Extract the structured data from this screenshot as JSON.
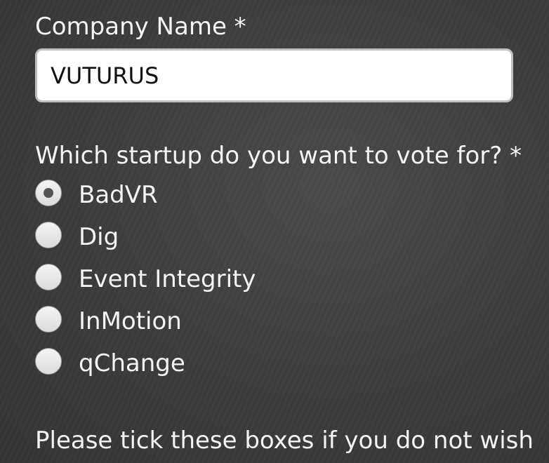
{
  "company_field": {
    "label": "Company Name *",
    "value": "VUTURUS"
  },
  "vote_question": {
    "label": "Which startup do you want to vote for? *",
    "selected": "BadVR",
    "options": [
      {
        "label": "BadVR",
        "checked": true
      },
      {
        "label": "Dig",
        "checked": false
      },
      {
        "label": "Event Integrity",
        "checked": false
      },
      {
        "label": "InMotion",
        "checked": false
      },
      {
        "label": "qChange",
        "checked": false
      }
    ]
  },
  "marketing_consent": {
    "label": "Please tick these boxes if you do not wish"
  }
}
